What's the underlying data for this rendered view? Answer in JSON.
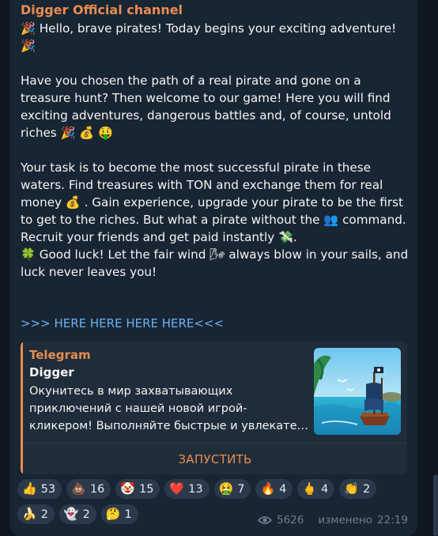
{
  "channel": {
    "name": "Digger Official channel"
  },
  "message": {
    "lines": [
      "🎉 Hello, brave pirates! Today begins your exciting adventure!",
      "🎉",
      "",
      "Have you chosen the path of a real pirate and gone on a",
      "treasure hunt? Then welcome to our game! Here you will find",
      "exciting adventures, dangerous battles and, of course, untold",
      "riches 🎉 💰 🤑",
      "",
      "Your task is to become the most successful pirate in these",
      "waters. Find treasures with TON and exchange them for real",
      "money 💰 . Gain experience, upgrade your pirate to be the first",
      "to get to the riches. But what a pirate without the 👥 command.",
      "Recruit your friends and get paid instantly 💸.",
      "🍀 Good luck! Let the fair wind 🌬 always blow in your sails, and",
      "luck never leaves you!"
    ],
    "link_text": ">>> HERE HERE HERE HERE<<<"
  },
  "preview": {
    "site": "Telegram",
    "title": "Digger",
    "description_lines": [
      "Окунитесь в мир захватывающих",
      "приключений с нашей новой игрой-",
      "кликером! Выполняйте быстрые и увлекате…"
    ],
    "button_label": "ЗАПУСТИТЬ"
  },
  "reactions": [
    {
      "emoji": "👍",
      "count": "53"
    },
    {
      "emoji": "💩",
      "count": "16"
    },
    {
      "emoji": "🤡",
      "count": "15"
    },
    {
      "emoji": "❤️",
      "count": "13"
    },
    {
      "emoji": "🤮",
      "count": "7"
    },
    {
      "emoji": "🔥",
      "count": "4"
    },
    {
      "emoji": "🖕",
      "count": "4"
    },
    {
      "emoji": "👏",
      "count": "2"
    },
    {
      "emoji": "🍌",
      "count": "2"
    },
    {
      "emoji": "👻",
      "count": "2"
    },
    {
      "emoji": "🤔",
      "count": "1"
    }
  ],
  "footer": {
    "views": "5626",
    "edited_label": "изменено",
    "time": "22:19",
    "views_icon": "eye-icon"
  },
  "colors": {
    "background": "#0e1621",
    "bubble": "#182533",
    "accent": "#e98d4f",
    "link": "#6ab3f3"
  }
}
